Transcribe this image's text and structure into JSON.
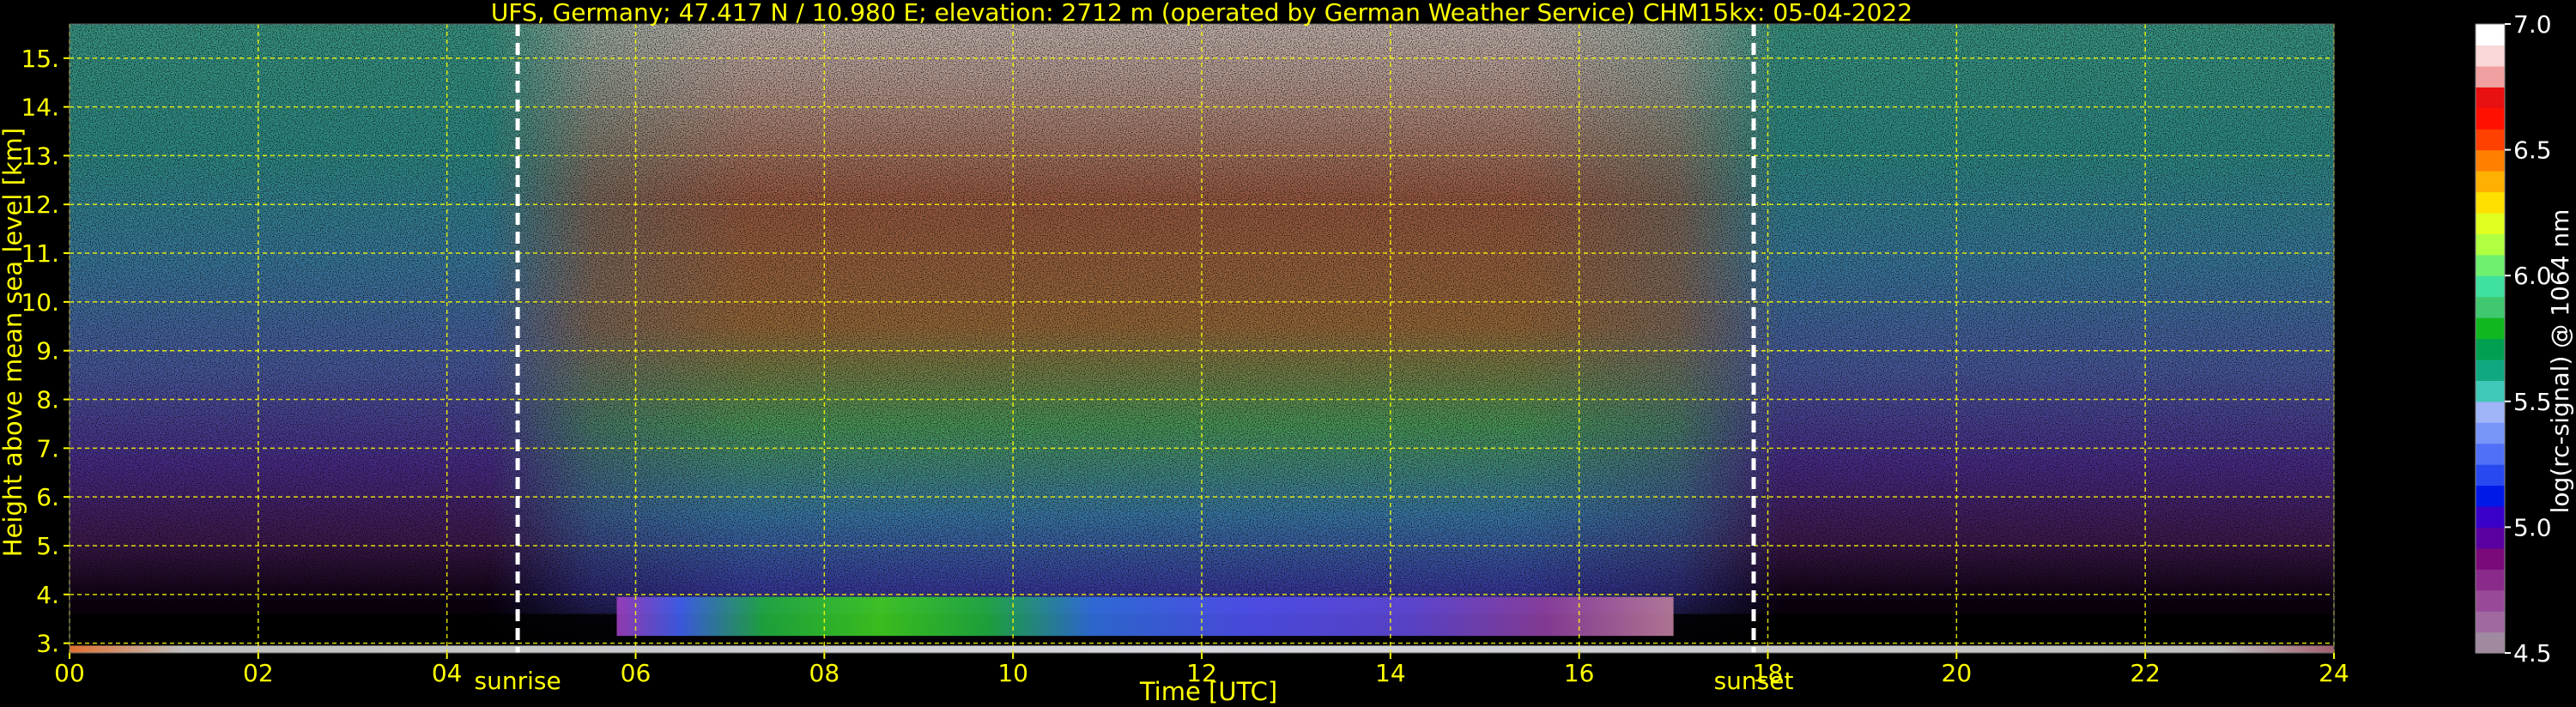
{
  "chart_data": {
    "type": "heatmap",
    "title": "UFS, Germany; 47.417 N / 10.980 E; elevation: 2712 m  (operated by German Weather Service)     CHM15kx: 05-04-2022",
    "xlabel": "Time [UTC]",
    "ylabel": "Height above mean sea level [km]",
    "xlim": [
      0,
      24
    ],
    "ylim": [
      2.8,
      15.7
    ],
    "x_ticks": [
      0,
      2,
      4,
      6,
      8,
      10,
      12,
      14,
      16,
      18,
      20,
      22,
      24
    ],
    "x_tick_labels": [
      "00",
      "02",
      "04",
      "06",
      "08",
      "10",
      "12",
      "14",
      "16",
      "18",
      "20",
      "22",
      "24"
    ],
    "y_ticks": [
      3,
      4,
      5,
      6,
      7,
      8,
      9,
      10,
      11,
      12,
      13,
      14,
      15
    ],
    "y_tick_labels": [
      "3.",
      "4.",
      "5.",
      "6.",
      "7.",
      "8.",
      "9.",
      "10.",
      "11.",
      "12.",
      "13.",
      "14.",
      "15."
    ],
    "grid": true,
    "grid_color": "#ffff00",
    "events": [
      {
        "label": "sunrise",
        "time": 4.75
      },
      {
        "label": "sunset",
        "time": 17.85
      }
    ],
    "layers": [
      {
        "type": "cloud",
        "start": 5.8,
        "end": 17.0,
        "bottom": 3.15,
        "top": 3.95
      },
      {
        "type": "surface",
        "start": 0,
        "end": 24,
        "bottom": 2.8,
        "top": 2.95
      }
    ],
    "colorbar": {
      "label": "log(rc-signal) @ 1064 nm",
      "range": [
        4.5,
        7.0
      ],
      "ticks": [
        4.5,
        5.0,
        5.5,
        6.0,
        6.5,
        7.0
      ],
      "tick_labels": [
        "4.5",
        "5.0",
        "5.5",
        "6.0",
        "6.5",
        "7.0"
      ],
      "colors": [
        "#a08aa0",
        "#a06aa0",
        "#984a98",
        "#8a2a8a",
        "#7a0a7a",
        "#5a00a0",
        "#3800c8",
        "#0018e8",
        "#2848f0",
        "#5070f8",
        "#7896f8",
        "#a0b4f8",
        "#40c8b8",
        "#10a880",
        "#00a050",
        "#10b820",
        "#40c870",
        "#40e0a0",
        "#70f070",
        "#b0ff40",
        "#e0ff20",
        "#ffe000",
        "#ffb000",
        "#ff8000",
        "#ff4000",
        "#ff1000",
        "#e81010",
        "#f0a0a0",
        "#f8d8d8",
        "#ffffff"
      ]
    }
  }
}
